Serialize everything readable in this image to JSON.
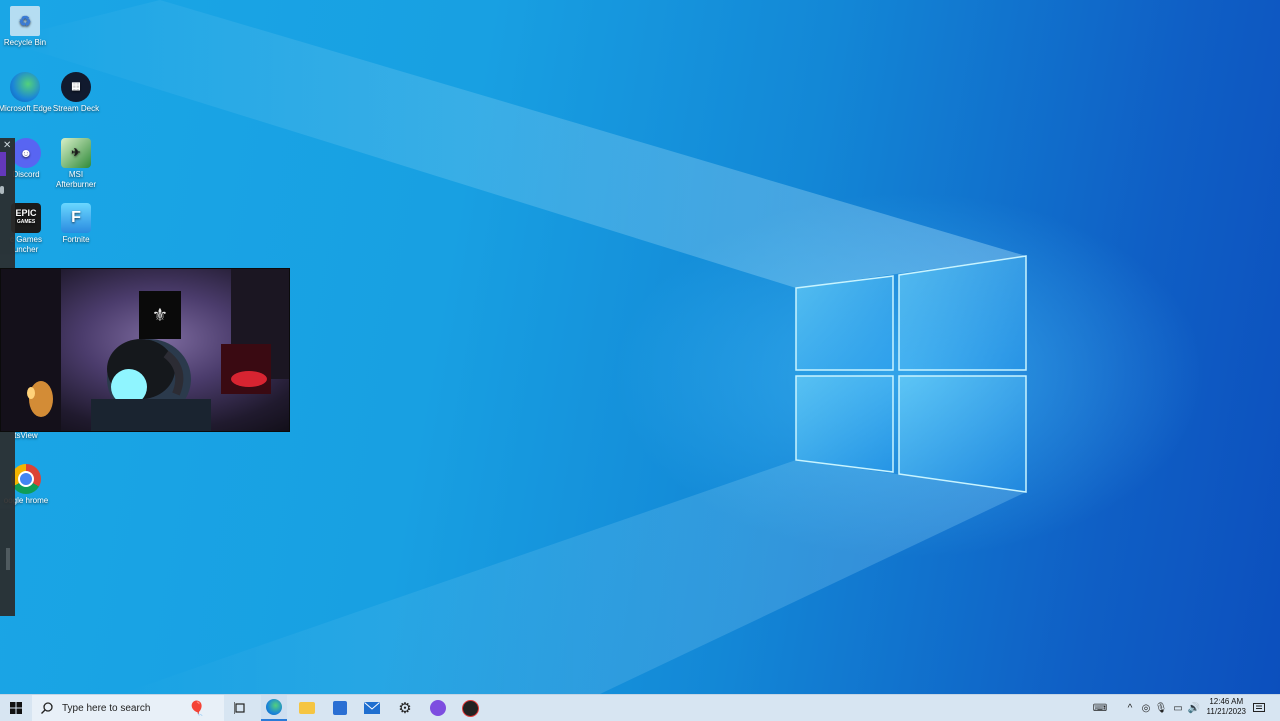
{
  "desktop": {
    "icons": [
      {
        "label": "Recycle Bin"
      },
      {
        "label": "Microsoft Edge"
      },
      {
        "label": "Stream Deck"
      },
      {
        "label": "Discord"
      },
      {
        "label": "MSI Afterburner"
      },
      {
        "label": "c Games uncher"
      },
      {
        "label": "Fortnite"
      },
      {
        "label": "tsView"
      },
      {
        "label": "oogle hrome"
      }
    ],
    "epic_logo_text": "EPIC",
    "epic_logo_sub": "GAMES",
    "fortnite_glyph": "F"
  },
  "colors": {
    "taskbar": "#d7e5f2",
    "desktop_accent": "#1aa6e6",
    "side_panel_accent": "#6b2fb8"
  },
  "taskbar": {
    "search_placeholder": "Type here to search",
    "clock": {
      "time": "12:46 AM",
      "date": "11/21/2023"
    },
    "apps": [
      "start-icon",
      "search-icon",
      "balloon-icon",
      "task-view-icon",
      "edge-icon",
      "file-explorer-icon",
      "store-icon",
      "mail-icon",
      "settings-icon",
      "photos-icon",
      "app-icon"
    ],
    "tray_icons": [
      "keyboard-icon",
      "chevron-up-icon",
      "camera-icon",
      "microphone-icon",
      "network-icon",
      "volume-icon",
      "notification-icon"
    ]
  }
}
